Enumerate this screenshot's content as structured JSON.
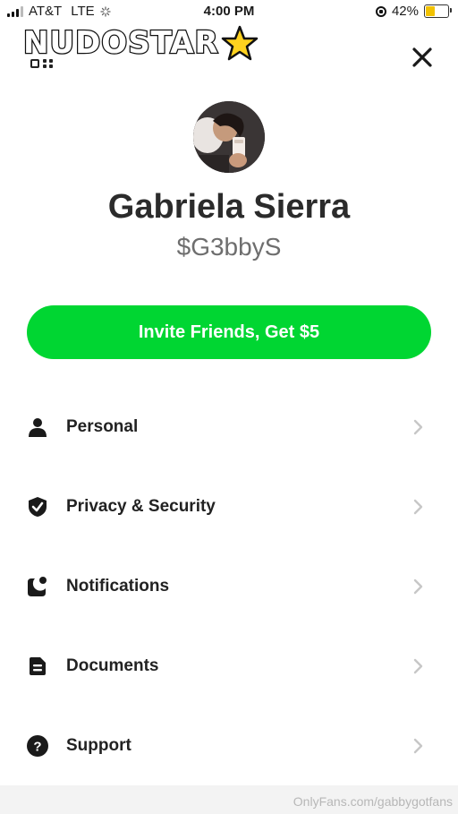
{
  "status_bar": {
    "carrier": "AT&T",
    "network": "LTE",
    "time": "4:00 PM",
    "battery": "42%",
    "battery_level": 0.42
  },
  "watermark": {
    "logo_text": "NUDOSTAR",
    "footer": "OnlyFans.com/gabbygotfans"
  },
  "profile": {
    "name": "Gabriela Sierra",
    "cashtag": "$G3bbyS"
  },
  "invite_button": "Invite Friends, Get $5",
  "menu": [
    {
      "label": "Personal",
      "icon": "person-icon"
    },
    {
      "label": "Privacy & Security",
      "icon": "shield-check-icon"
    },
    {
      "label": "Notifications",
      "icon": "notification-icon"
    },
    {
      "label": "Documents",
      "icon": "document-icon"
    },
    {
      "label": "Support",
      "icon": "help-icon"
    }
  ],
  "colors": {
    "accent_green": "#00d632",
    "battery_yellow": "#f2c200",
    "chevron": "#c7c7c7"
  }
}
